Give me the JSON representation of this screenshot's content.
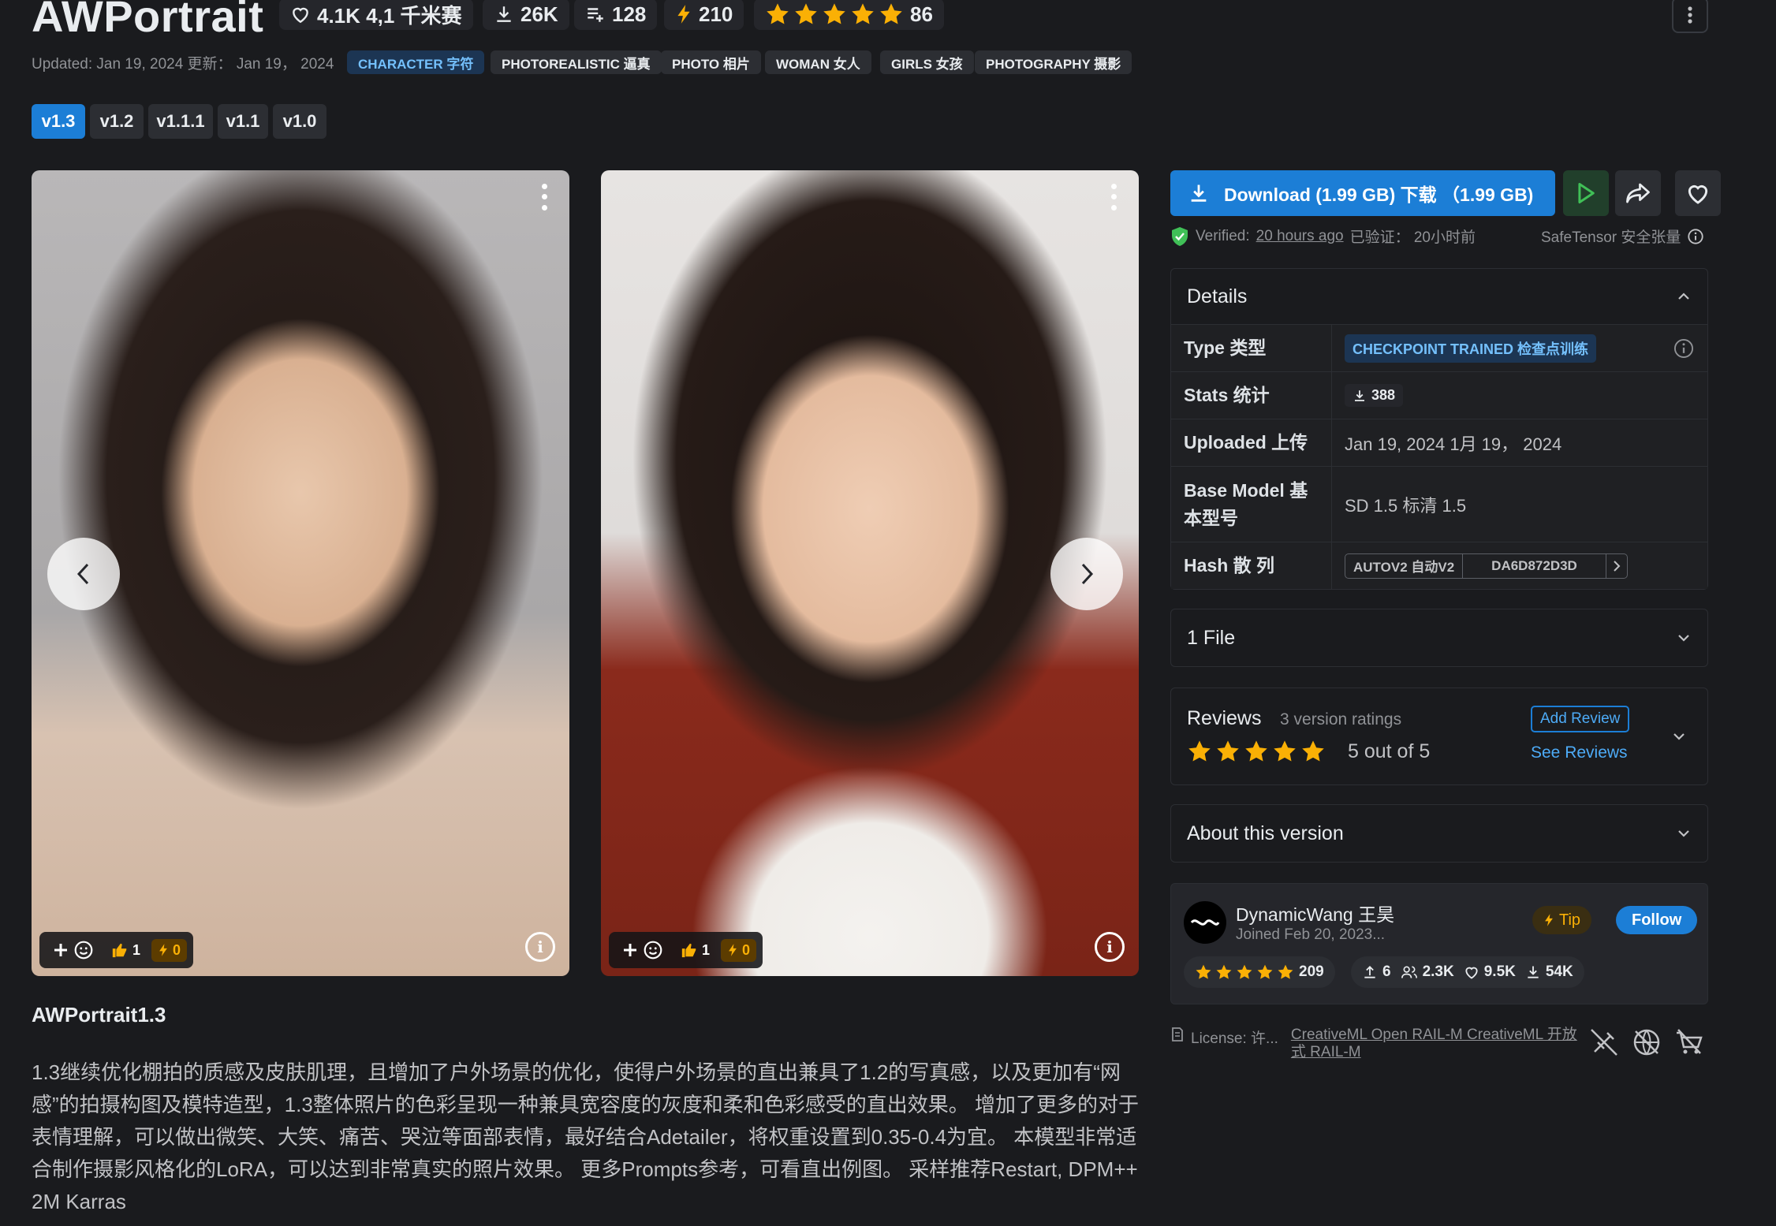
{
  "header": {
    "title": "AWPortrait",
    "likes": "4.1K 4,1 千米赛",
    "downloads": "26K",
    "collections": "128",
    "buzz": "210",
    "rating_count": "86",
    "updated": "Updated: Jan 19, 2024 更新： Jan 19， 2024",
    "tags": [
      "CHARACTER 字符",
      "PHOTOREALISTIC 逼真",
      "PHOTO 相片",
      "WOMAN 女人",
      "GIRLS 女孩",
      "PHOTOGRAPHY 摄影"
    ]
  },
  "versions": [
    "v1.3",
    "v1.2",
    "v1.1.1",
    "v1.1",
    "v1.0"
  ],
  "active_version": "v1.3",
  "gallery": {
    "card1": {
      "likes": "1",
      "buzz": "0"
    },
    "card2": {
      "likes": "1",
      "buzz": "0"
    }
  },
  "description": {
    "title": "AWPortrait1.3",
    "body": "1.3继续优化棚拍的质感及皮肤肌理，且增加了户外场景的优化，使得户外场景的直出兼具了1.2的写真感，以及更加有“网感”的拍摄构图及模特造型，1.3整体照片的色彩呈现一种兼具宽容度的灰度和柔和色彩感受的直出效果。 增加了更多的对于表情理解，可以做出微笑、大笑、痛苦、哭泣等面部表情，最好结合Adetailer，将权重设置到0.35-0.4为宜。 本模型非常适合制作摄影风格化的LoRA，可以达到非常真实的照片效果。 更多Prompts参考，可看直出例图。 采样推荐Restart, DPM++ 2M Karras"
  },
  "download": {
    "label": "Download (1.99 GB) 下载 （1.99 GB)",
    "verified_prefix": "Verified:",
    "verified_time": "20 hours ago",
    "verified_suffix": "已验证： 20小时前",
    "safetensor": "SafeTensor 安全张量"
  },
  "details": {
    "heading": "Details",
    "rows": [
      {
        "key": "Type 类型",
        "value": "CHECKPOINT TRAINED 检查点训练"
      },
      {
        "key": "Stats 统计",
        "value": "388"
      },
      {
        "key": "Uploaded 上传",
        "value": "Jan 19, 2024 1月 19， 2024"
      },
      {
        "key": "Base Model 基本型号",
        "value": "SD 1.5 标清 1.5"
      },
      {
        "key": "Hash 散 列",
        "hash_type": "AUTOV2 自动V2",
        "hash_value": "DA6D872D3D"
      }
    ]
  },
  "files": {
    "heading": "1 File"
  },
  "reviews": {
    "heading": "Reviews",
    "count": "3 version ratings",
    "score": "5 out of 5",
    "add_label": "Add Review",
    "see_label": "See Reviews"
  },
  "about": {
    "heading": "About this version"
  },
  "creator": {
    "name": "DynamicWang 王昊",
    "joined": "Joined Feb 20, 2023...",
    "tip_label": "Tip",
    "follow_label": "Follow",
    "rating": "209",
    "uploads": "6",
    "followers": "2.3K",
    "likes": "9.5K",
    "downloads": "54K"
  },
  "license": {
    "label": "License: 许...",
    "text": "CreativeML Open RAIL-M CreativeML 开放式 RAIL-M"
  },
  "colors": {
    "accent": "#1c7ed6",
    "star": "#fab005",
    "bg": "#1a1b1e",
    "verified": "#40c057"
  }
}
